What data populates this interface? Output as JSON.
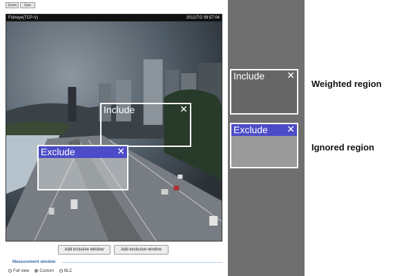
{
  "top_buttons": [
    "Zoom",
    "Size"
  ],
  "camera": {
    "title": "Fisheye(TCP-V)",
    "timestamp": "2012/7/2 09:57:04"
  },
  "overlays": {
    "include": {
      "label": "Include",
      "close": "✕",
      "color": "#ffffff"
    },
    "exclude": {
      "label": "Exclude",
      "close": "✕",
      "color": "#4c4cc8"
    }
  },
  "controls": {
    "add_inclusive": "Add inclusive window",
    "add_exclusive": "Add exclusive window",
    "measurement_title": "Measurement window",
    "radio_options": [
      "Full view",
      "Custom",
      "BLC"
    ],
    "radio_selected": "Custom"
  },
  "legend": {
    "include": {
      "label": "Include",
      "close": "✕",
      "description": "Weighted region",
      "fill": "#666666"
    },
    "exclude": {
      "label": "Exclude",
      "close": "✕",
      "description": "Ignored region",
      "head_color": "#4c4cc8",
      "fill": "#9a9a9a"
    }
  }
}
